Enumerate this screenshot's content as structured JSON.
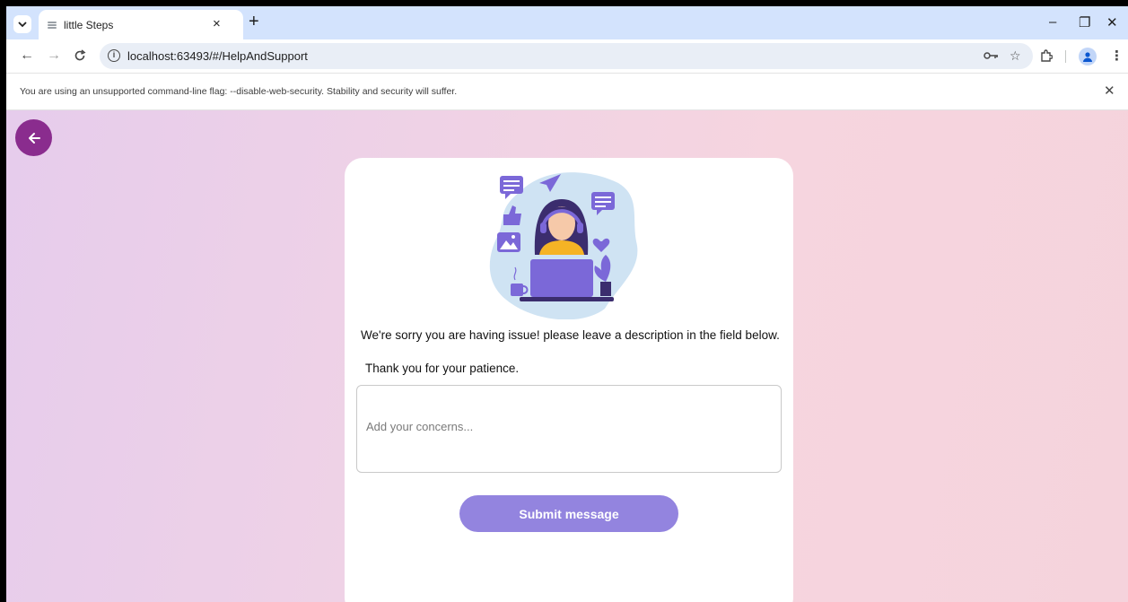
{
  "browser": {
    "tab_title": "little Steps",
    "tab_close": "×",
    "new_tab": "+",
    "url": "localhost:63493/#/HelpAndSupport",
    "window_controls": {
      "minimize": "–",
      "restore": "❐",
      "close": "✕"
    }
  },
  "infobar": {
    "message": "You are using an unsupported command-line flag: --disable-web-security. Stability and security will suffer.",
    "close": "✕"
  },
  "support_page": {
    "message_line1": "We're sorry you are having issue! please leave a description in the field below.",
    "message_line2": "Thank you for your patience.",
    "concern_placeholder": "Add your concerns...",
    "submit_label": "Submit message"
  },
  "colors": {
    "back_button": "#8a2c8e",
    "submit_button": "#9384df",
    "illustration_accent": "#7b68d8",
    "illustration_blob": "#cfe3f3",
    "headset_person_shirt": "#f5b325"
  },
  "icons": [
    "tab-search-icon",
    "back-arrow-icon",
    "forward-arrow-icon",
    "reload-icon",
    "info-icon",
    "password-key-icon",
    "bookmark-star-icon",
    "extensions-icon",
    "profile-icon",
    "menu-kebab-icon",
    "page-back-arrow-icon"
  ]
}
